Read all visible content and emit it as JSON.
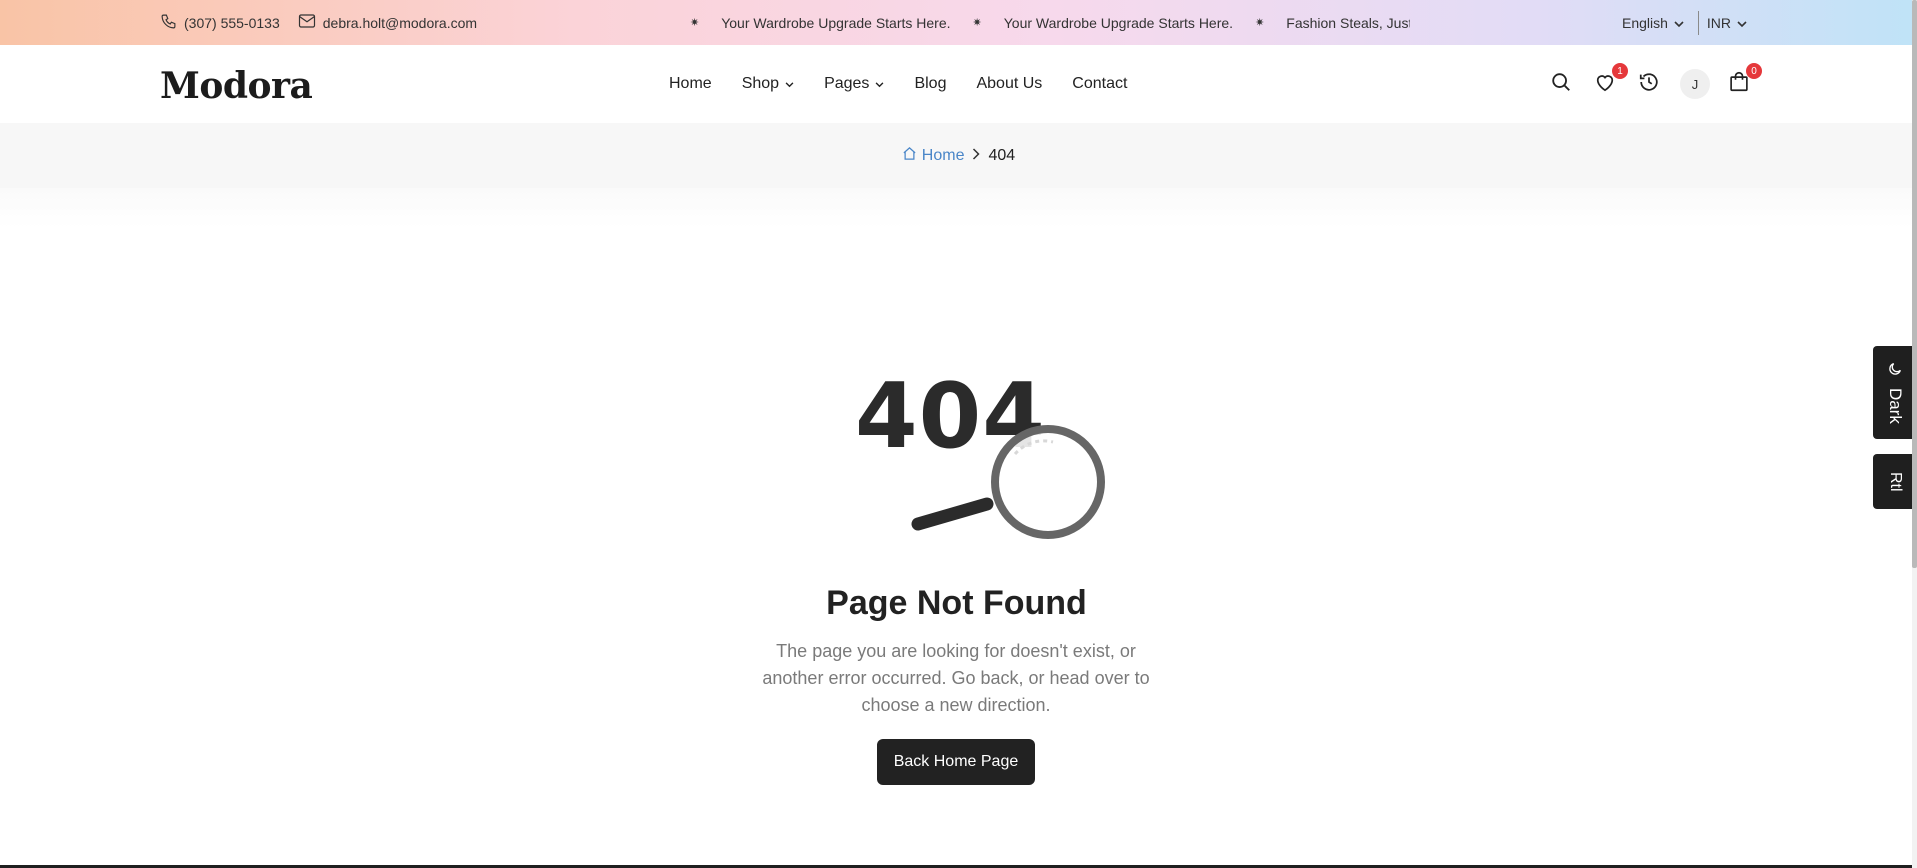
{
  "topbar": {
    "phone": "(307) 555-0133",
    "email": "debra.holt@modora.com",
    "messages": [
      "Your Wardrobe Upgrade Starts Here.",
      "Your Wardrobe Upgrade Starts Here.",
      "Fashion Steals, Just for Y"
    ],
    "language": "English",
    "currency": "INR"
  },
  "header": {
    "logo": "Modora",
    "nav": [
      {
        "label": "Home",
        "dropdown": false
      },
      {
        "label": "Shop",
        "dropdown": true
      },
      {
        "label": "Pages",
        "dropdown": true
      },
      {
        "label": "Blog",
        "dropdown": false
      },
      {
        "label": "About Us",
        "dropdown": false
      },
      {
        "label": "Contact",
        "dropdown": false
      }
    ],
    "wishlist_count": "1",
    "avatar_initial": "J",
    "cart_count": "0",
    "icons": [
      "search-icon",
      "heart-icon",
      "history-icon",
      "avatar",
      "bag-icon"
    ]
  },
  "breadcrumb": {
    "home": "Home",
    "current": "404"
  },
  "error": {
    "code": "404",
    "title": "Page Not Found",
    "description": "The page you are looking for doesn't exist, or another error occurred. Go back, or head over to choose a new direction.",
    "button": "Back Home Page"
  },
  "side": {
    "dark_label": "Dark",
    "rtl_label": "Rtl"
  },
  "colors": {
    "primary_dark": "#222222",
    "link_blue": "#4a86c8",
    "badge_red": "#e5383b"
  }
}
